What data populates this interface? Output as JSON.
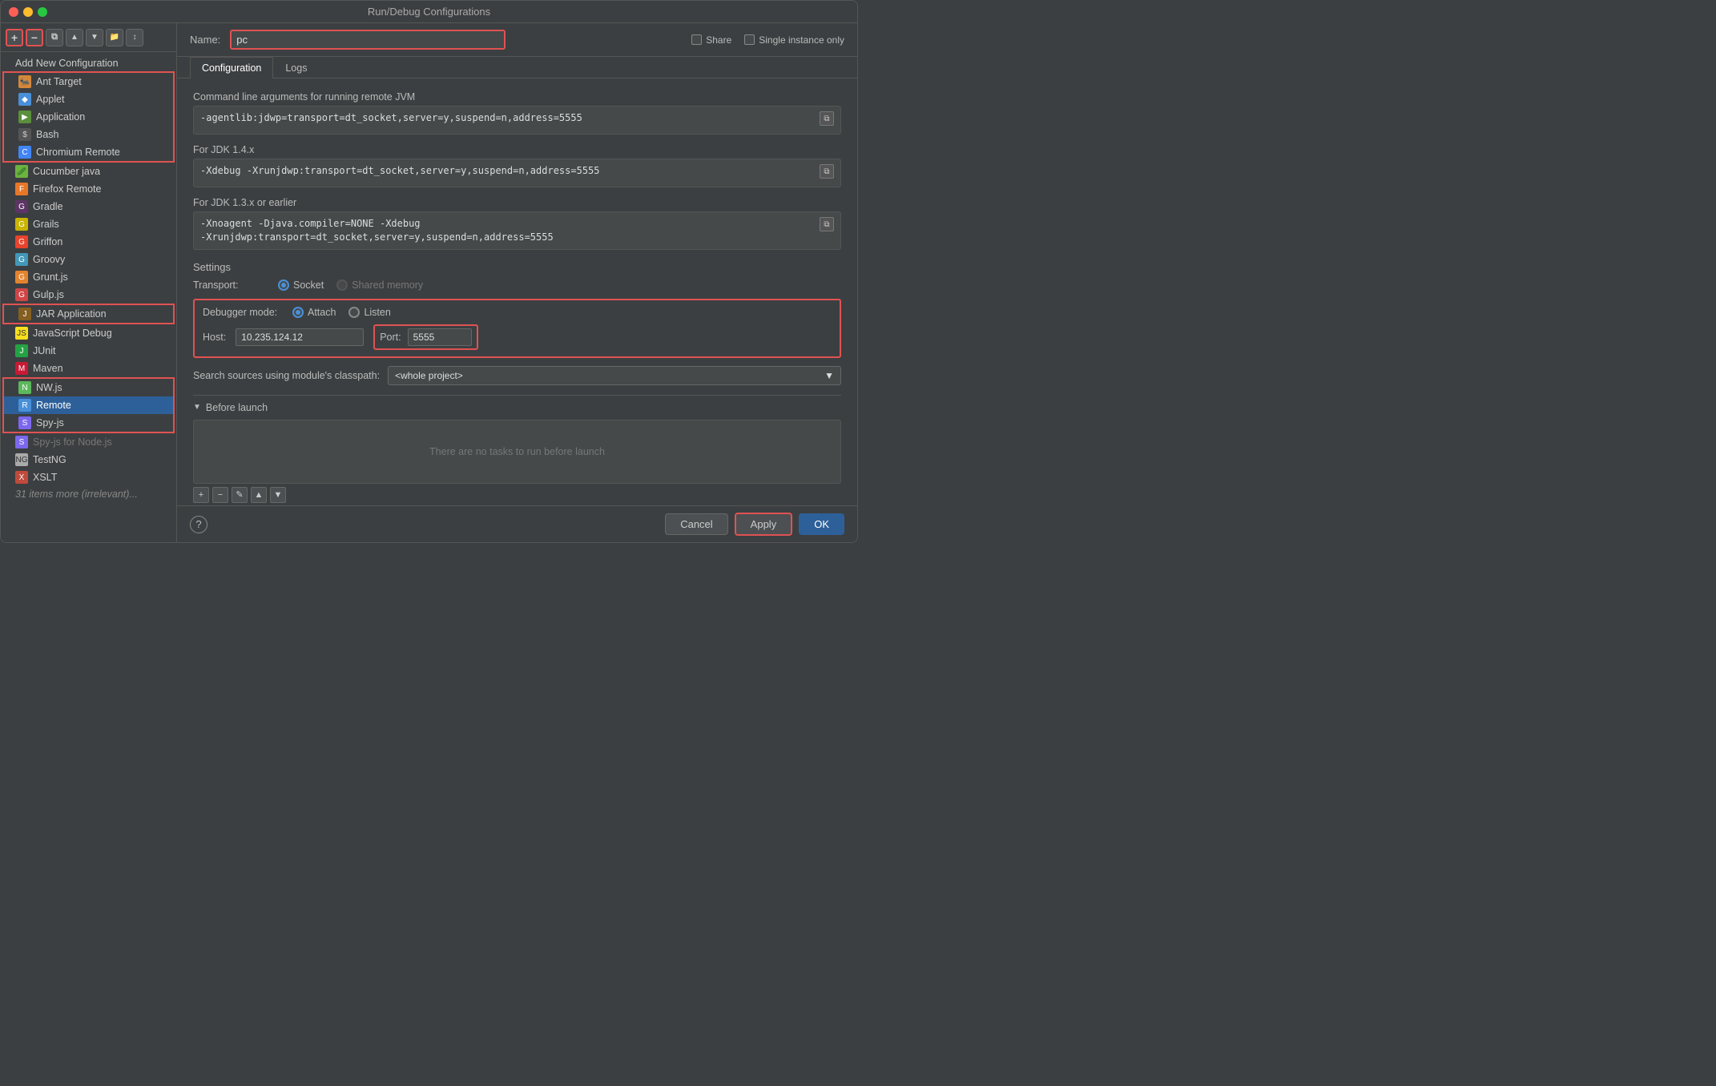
{
  "window": {
    "title": "Run/Debug Configurations"
  },
  "toolbar": {
    "add_label": "+",
    "remove_label": "−",
    "copy_label": "⧉",
    "move_up_label": "▲",
    "move_down_label": "▼",
    "folder_label": "📁",
    "sort_label": "↕"
  },
  "left_panel": {
    "add_new_label": "Add New Configuration",
    "items": [
      {
        "id": "ant-target",
        "label": "Ant Target",
        "icon": "🐜",
        "icon_class": "icon-ant"
      },
      {
        "id": "applet",
        "label": "Applet",
        "icon": "🔷",
        "icon_class": "icon-applet"
      },
      {
        "id": "application",
        "label": "Application",
        "icon": "▶",
        "icon_class": "icon-app"
      },
      {
        "id": "bash",
        "label": "Bash",
        "icon": "$",
        "icon_class": "icon-bash"
      },
      {
        "id": "chromium-remote",
        "label": "Chromium Remote",
        "icon": "C",
        "icon_class": "icon-chromium"
      },
      {
        "id": "cucumber-java",
        "label": "Cucumber java",
        "icon": "🥒",
        "icon_class": "icon-cucumber"
      },
      {
        "id": "firefox-remote",
        "label": "Firefox Remote",
        "icon": "F",
        "icon_class": "icon-firefox"
      },
      {
        "id": "gradle",
        "label": "Gradle",
        "icon": "G",
        "icon_class": "icon-gradle"
      },
      {
        "id": "grails",
        "label": "Grails",
        "icon": "G",
        "icon_class": "icon-grails"
      },
      {
        "id": "griffon",
        "label": "Griffon",
        "icon": "G",
        "icon_class": "icon-griffon"
      },
      {
        "id": "groovy",
        "label": "Groovy",
        "icon": "G",
        "icon_class": "icon-groovy"
      },
      {
        "id": "gruntjs",
        "label": "Grunt.js",
        "icon": "G",
        "icon_class": "icon-gruntjs"
      },
      {
        "id": "gulpjs",
        "label": "Gulp.js",
        "icon": "G",
        "icon_class": "icon-gulpjs"
      },
      {
        "id": "jar-application",
        "label": "JAR Application",
        "icon": "J",
        "icon_class": "icon-jar"
      },
      {
        "id": "javascript-debug",
        "label": "JavaScript Debug",
        "icon": "J",
        "icon_class": "icon-jsdebug"
      },
      {
        "id": "junit",
        "label": "JUnit",
        "icon": "J",
        "icon_class": "icon-junit"
      },
      {
        "id": "maven",
        "label": "Maven",
        "icon": "M",
        "icon_class": "icon-maven"
      },
      {
        "id": "nwjs",
        "label": "NW.js",
        "icon": "N",
        "icon_class": "icon-nwjs"
      },
      {
        "id": "remote",
        "label": "Remote",
        "icon": "R",
        "icon_class": "icon-remote",
        "selected": true
      },
      {
        "id": "spy-js",
        "label": "Spy-js",
        "icon": "S",
        "icon_class": "icon-spyjs"
      },
      {
        "id": "spy-js-nodejs",
        "label": "Spy-js for Node.js",
        "icon": "S",
        "icon_class": "icon-spyjs",
        "partial": true
      },
      {
        "id": "testng",
        "label": "TestNG",
        "icon": "T",
        "icon_class": "icon-testng"
      },
      {
        "id": "xslt",
        "label": "XSLT",
        "icon": "X",
        "icon_class": "icon-xslt"
      },
      {
        "id": "more",
        "label": "31 items more (irrelevant)..."
      }
    ]
  },
  "right_panel": {
    "name_label": "Name:",
    "name_value": "pc",
    "share_label": "Share",
    "single_instance_label": "Single instance only",
    "tabs": [
      {
        "id": "configuration",
        "label": "Configuration",
        "active": true
      },
      {
        "id": "logs",
        "label": "Logs",
        "active": false
      }
    ],
    "cmd_jvm_label": "Command line arguments for running remote JVM",
    "cmd_jvm_value": "-agentlib:jdwp=transport=dt_socket,server=y,suspend=n,address=5555",
    "cmd_jdk14_label": "For JDK 1.4.x",
    "cmd_jdk14_value": "-Xdebug -Xrunjdwp:transport=dt_socket,server=y,suspend=n,address=5555",
    "cmd_jdk13_label": "For JDK 1.3.x or earlier",
    "cmd_jdk13_value": "-Xnoagent -Djava.compiler=NONE -Xdebug\n-Xrunjdwp:transport=dt_socket,server=y,suspend=n,address=5555",
    "settings_label": "Settings",
    "transport_label": "Transport:",
    "transport_options": [
      {
        "id": "socket",
        "label": "Socket",
        "checked": true
      },
      {
        "id": "shared-memory",
        "label": "Shared memory",
        "checked": false
      }
    ],
    "debugger_mode_label": "Debugger mode:",
    "debugger_modes": [
      {
        "id": "attach",
        "label": "Attach",
        "checked": true
      },
      {
        "id": "listen",
        "label": "Listen",
        "checked": false
      }
    ],
    "host_label": "Host:",
    "host_value": "10.235.124.12",
    "port_label": "Port:",
    "port_value": "5555",
    "classpath_label": "Search sources using module's classpath:",
    "classpath_value": "<whole project>",
    "before_launch_label": "Before launch",
    "before_launch_empty": "There are no tasks to run before launch",
    "before_launch_buttons": [
      "+",
      "−",
      "✎",
      "▲",
      "▼"
    ]
  },
  "bottom_bar": {
    "cancel_label": "Cancel",
    "apply_label": "Apply",
    "ok_label": "OK"
  }
}
